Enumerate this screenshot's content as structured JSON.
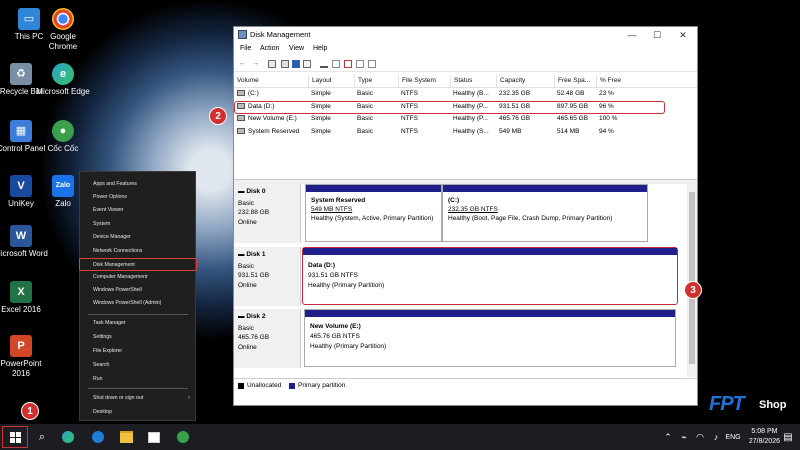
{
  "desktop": {
    "icons": [
      {
        "label": "This PC",
        "icon": "computer-icon",
        "color": "#2f86d6"
      },
      {
        "label": "Google Chrome",
        "icon": "chrome-icon",
        "color": "#e34133"
      },
      {
        "label": "Recycle Bin",
        "icon": "recycle-bin-icon",
        "color": "#7a8fa6"
      },
      {
        "label": "Microsoft Edge",
        "icon": "edge-icon",
        "color": "#2aa3c9"
      },
      {
        "label": "Control Panel",
        "icon": "control-panel-icon",
        "color": "#3b7dd8"
      },
      {
        "label": "Cốc Cốc",
        "icon": "coccoc-icon",
        "color": "#3aa14a"
      },
      {
        "label": "UniKey",
        "icon": "unikey-icon",
        "color": "#1a4aa0"
      },
      {
        "label": "Zalo",
        "icon": "zalo-icon",
        "color": "#1a73e8"
      },
      {
        "label": "Microsoft Word",
        "icon": "word-icon",
        "color": "#2b579a"
      },
      {
        "label": "Excel 2016",
        "icon": "excel-icon",
        "color": "#217346"
      },
      {
        "label": "PowerPoint 2016",
        "icon": "powerpoint-icon",
        "color": "#d24726"
      }
    ]
  },
  "context_menu": {
    "items": [
      "Apps and Features",
      "Power Options",
      "Event Viewer",
      "System",
      "Device Manager",
      "Network Connections",
      "Disk Management",
      "Computer Management",
      "Windows PowerShell",
      "Windows PowerShell (Admin)",
      "Task Manager",
      "Settings",
      "File Explorer",
      "Search",
      "Run",
      "Shut down or sign out",
      "Desktop"
    ],
    "highlighted": "Disk Management"
  },
  "window": {
    "title": "Disk Management",
    "menu": [
      "File",
      "Action",
      "View",
      "Help"
    ],
    "controls": {
      "minimize": "—",
      "maximize": "☐",
      "close": "✕"
    }
  },
  "volume_table": {
    "columns": [
      "Volume",
      "Layout",
      "Type",
      "File System",
      "Status",
      "Capacity",
      "Free Spa...",
      "% Free"
    ],
    "rows": [
      [
        "(C:)",
        "Simple",
        "Basic",
        "NTFS",
        "Healthy (B...",
        "232.35 GB",
        "52.48 GB",
        "23 %"
      ],
      [
        "Data (D:)",
        "Simple",
        "Basic",
        "NTFS",
        "Healthy (P...",
        "931.51 GB",
        "897.95 GB",
        "96 %"
      ],
      [
        "New Volume (E:)",
        "Simple",
        "Basic",
        "NTFS",
        "Healthy (P...",
        "465.76 GB",
        "465.65 GB",
        "100 %"
      ],
      [
        "System Reserved",
        "Simple",
        "Basic",
        "NTFS",
        "Healthy (S...",
        "549 MB",
        "514 MB",
        "94 %"
      ]
    ]
  },
  "disks": [
    {
      "name": "Disk 0",
      "type": "Basic",
      "size": "232.88 GB",
      "state": "Online",
      "partitions": [
        {
          "name": "System Reserved",
          "size": "549 MB NTFS",
          "status": "Healthy (System, Active, Primary Partition)"
        },
        {
          "name": "(C:)",
          "size": "232.35 GB NTFS",
          "status": "Healthy (Boot, Page File, Crash Dump, Primary Partition)"
        }
      ]
    },
    {
      "name": "Disk 1",
      "type": "Basic",
      "size": "931.51 GB",
      "state": "Online",
      "partitions": [
        {
          "name": "Data  (D:)",
          "size": "931.51 GB NTFS",
          "status": "Healthy (Primary Partition)"
        }
      ]
    },
    {
      "name": "Disk 2",
      "type": "Basic",
      "size": "465.76 GB",
      "state": "Online",
      "partitions": [
        {
          "name": "New Volume  (E:)",
          "size": "465.76 GB NTFS",
          "status": "Healthy (Primary Partition)"
        }
      ]
    }
  ],
  "legend": {
    "unallocated": "Unallocated",
    "primary": "Primary partition"
  },
  "badges": [
    "1",
    "2",
    "3"
  ],
  "taskbar": {
    "time": "5:08 PM",
    "date": "27/8/2026",
    "language": "ENG"
  },
  "watermark": {
    "brand": "FPT",
    "suffix": "Shop"
  },
  "colors": {
    "highlight": "#d03030",
    "partition_bar": "#1f1f8a"
  }
}
